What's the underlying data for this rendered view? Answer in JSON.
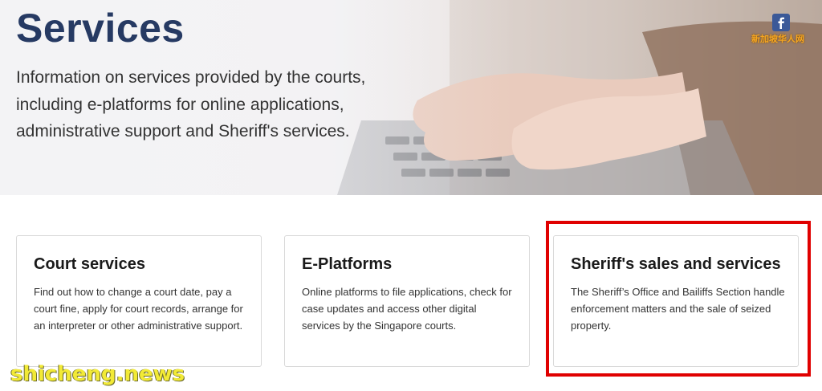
{
  "hero": {
    "title": "Services",
    "description": "Information on services provided by the courts, including e-platforms for online applications, administrative support and Sheriff's services."
  },
  "cards": [
    {
      "title": "Court services",
      "description": "Find out how to change a court date, pay a court fine, apply for court records, arrange for an interpreter or other administrative support."
    },
    {
      "title": "E-Platforms",
      "description": "Online platforms to file applications, check for case updates and access other digital services by the Singapore courts."
    },
    {
      "title": "Sheriff's sales and services",
      "description": "The Sheriff’s Office and Bailiffs Section handle enforcement matters and the sale of seized property."
    }
  ],
  "watermarks": {
    "facebook_letter": "f",
    "chinese_site": "新加坡华人网",
    "site": "shicheng.news"
  },
  "colors": {
    "title": "#263a63",
    "highlight_border": "#e00000",
    "watermark_site": "#f2ea36"
  }
}
